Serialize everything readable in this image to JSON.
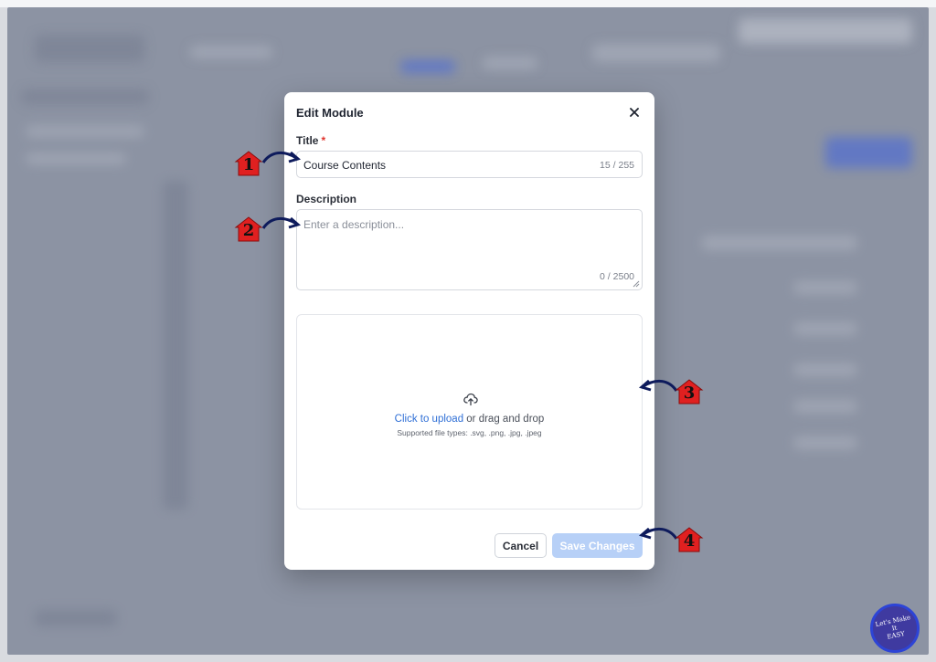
{
  "modal": {
    "title": "Edit Module",
    "title_field": {
      "label": "Title",
      "required_mark": "*",
      "value": "Course Contents",
      "counter": "15 / 255"
    },
    "description_field": {
      "label": "Description",
      "placeholder": "Enter a description...",
      "counter": "0 / 2500"
    },
    "upload": {
      "link_text": "Click to upload",
      "rest_text": " or drag and drop",
      "supported": "Supported file types: .svg, .png, .jpg, .jpeg"
    },
    "buttons": {
      "cancel": "Cancel",
      "save": "Save Changes"
    }
  },
  "annotations": [
    "1",
    "2",
    "3",
    "4"
  ],
  "badge": {
    "line1": "Let's Make",
    "line2": "It",
    "line3": "EASY"
  },
  "colors": {
    "overlay": "#8c93a3",
    "accent": "#2f6fd6",
    "save_disabled": "#b7d0f7",
    "marker_red": "#e02020"
  }
}
